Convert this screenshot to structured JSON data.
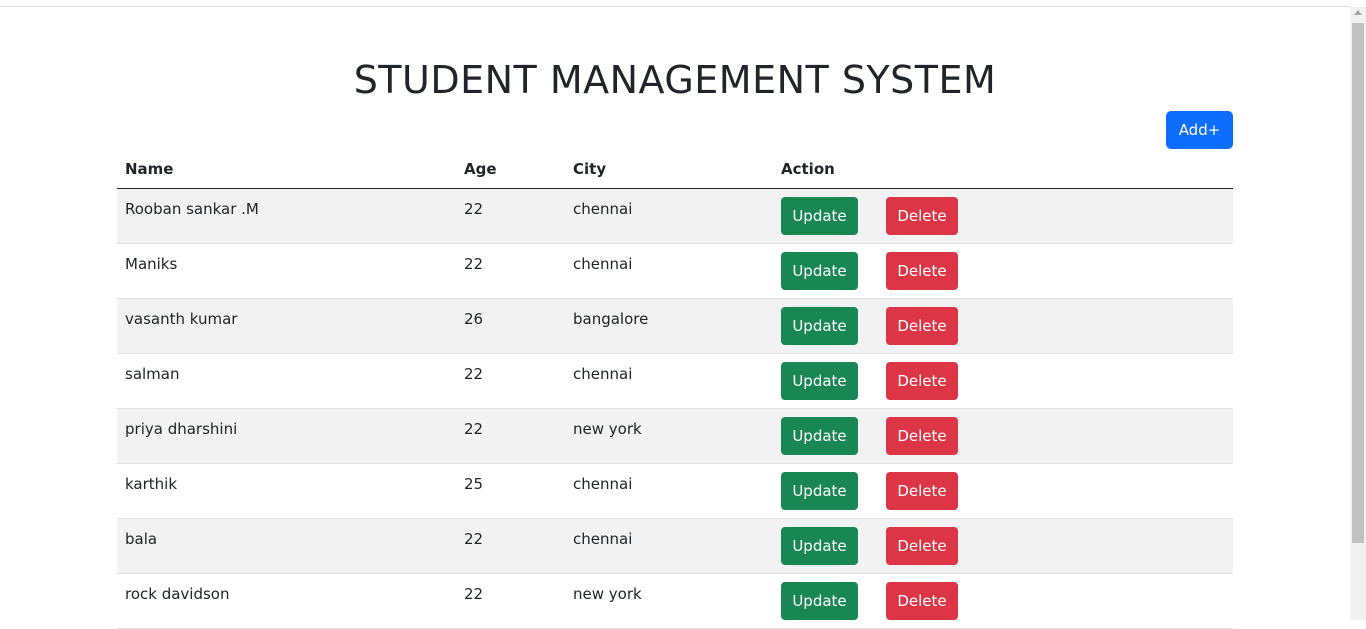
{
  "header": {
    "title": "STUDENT MANAGEMENT SYSTEM"
  },
  "toolbar": {
    "add_label": "Add+"
  },
  "table": {
    "columns": [
      "Name",
      "Age",
      "City",
      "Action"
    ],
    "update_label": "Update",
    "delete_label": "Delete",
    "rows": [
      {
        "name": "Rooban sankar .M",
        "age": "22",
        "city": "chennai"
      },
      {
        "name": "Maniks",
        "age": "22",
        "city": "chennai"
      },
      {
        "name": "vasanth kumar",
        "age": "26",
        "city": "bangalore"
      },
      {
        "name": "salman",
        "age": "22",
        "city": "chennai"
      },
      {
        "name": "priya dharshini",
        "age": "22",
        "city": "new york"
      },
      {
        "name": "karthik",
        "age": "25",
        "city": "chennai"
      },
      {
        "name": "bala",
        "age": "22",
        "city": "chennai"
      },
      {
        "name": "rock davidson",
        "age": "22",
        "city": "new york"
      }
    ]
  },
  "colors": {
    "add": "#0d6efd",
    "update": "#198754",
    "delete": "#dc3545",
    "stripe": "#f2f2f2"
  }
}
